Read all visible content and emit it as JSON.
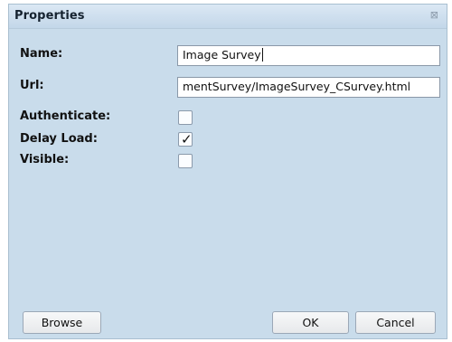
{
  "dialog": {
    "title": "Properties",
    "close_glyph": "⊠"
  },
  "fields": {
    "name_label": "Name:",
    "name_value": "Image Survey",
    "url_label": "Url:",
    "url_value": "mentSurvey/ImageSurvey_CSurvey.html",
    "authenticate_label": "Authenticate:",
    "delay_load_label": "Delay Load:",
    "visible_label": "Visible:",
    "authenticate_checked": false,
    "delay_load_checked": true,
    "visible_checked": false,
    "checkmark_glyph": "✓"
  },
  "buttons": {
    "browse": "Browse",
    "ok": "OK",
    "cancel": "Cancel"
  },
  "icons": {
    "close": "close-icon",
    "checkmark": "checkmark-icon"
  },
  "colors": {
    "dialog_background": "#c9dceb",
    "title_background": "#d3e3f1",
    "field_border": "#8a98a8"
  }
}
